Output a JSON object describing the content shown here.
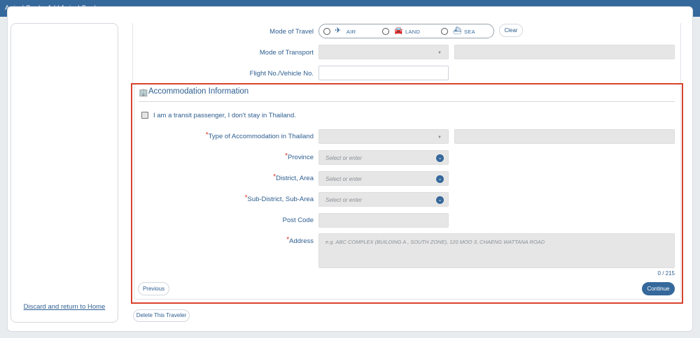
{
  "header": {
    "breadcrumb": "Arrival Card > Add Arrival Card"
  },
  "sidebar": {
    "discard_link": "Discard and return to Home"
  },
  "travel": {
    "mode_label": "Mode of Travel",
    "modes": [
      {
        "label": "AIR",
        "icon": "airplane-icon"
      },
      {
        "label": "LAND",
        "icon": "car-icon"
      },
      {
        "label": "SEA",
        "icon": "ship-icon"
      }
    ],
    "clear_button": "Clear",
    "transport_label": "Mode of Transport",
    "flight_label": "Flight No./Vehicle No.",
    "flight_value": ""
  },
  "accommodation": {
    "title": "Accommodation Information",
    "transit_checkbox_label": "I am a transit passenger, I don't stay in Thailand.",
    "required_mark": "*",
    "type_label": "Type of Accommodation in Thailand",
    "province_label": "Province",
    "province_placeholder": "Select or enter",
    "district_label": "District, Area",
    "district_placeholder": "Select or enter",
    "subdistrict_label": "Sub-District, Sub-Area",
    "subdistrict_placeholder": "Select or enter",
    "postcode_label": "Post Code",
    "address_label": "Address",
    "address_placeholder": "e.g. ABC COMPLEX (BUILDING A , SOUTH ZONE), 120 MOO 3, CHAENG WATTANA ROAD",
    "char_counter": "0 / 215"
  },
  "actions": {
    "previous": "Previous",
    "continue": "Continue",
    "delete_traveler": "Delete This Traveler"
  },
  "colors": {
    "primary": "#35689b",
    "highlight": "#d9432e",
    "field": "#e6e6e6"
  }
}
